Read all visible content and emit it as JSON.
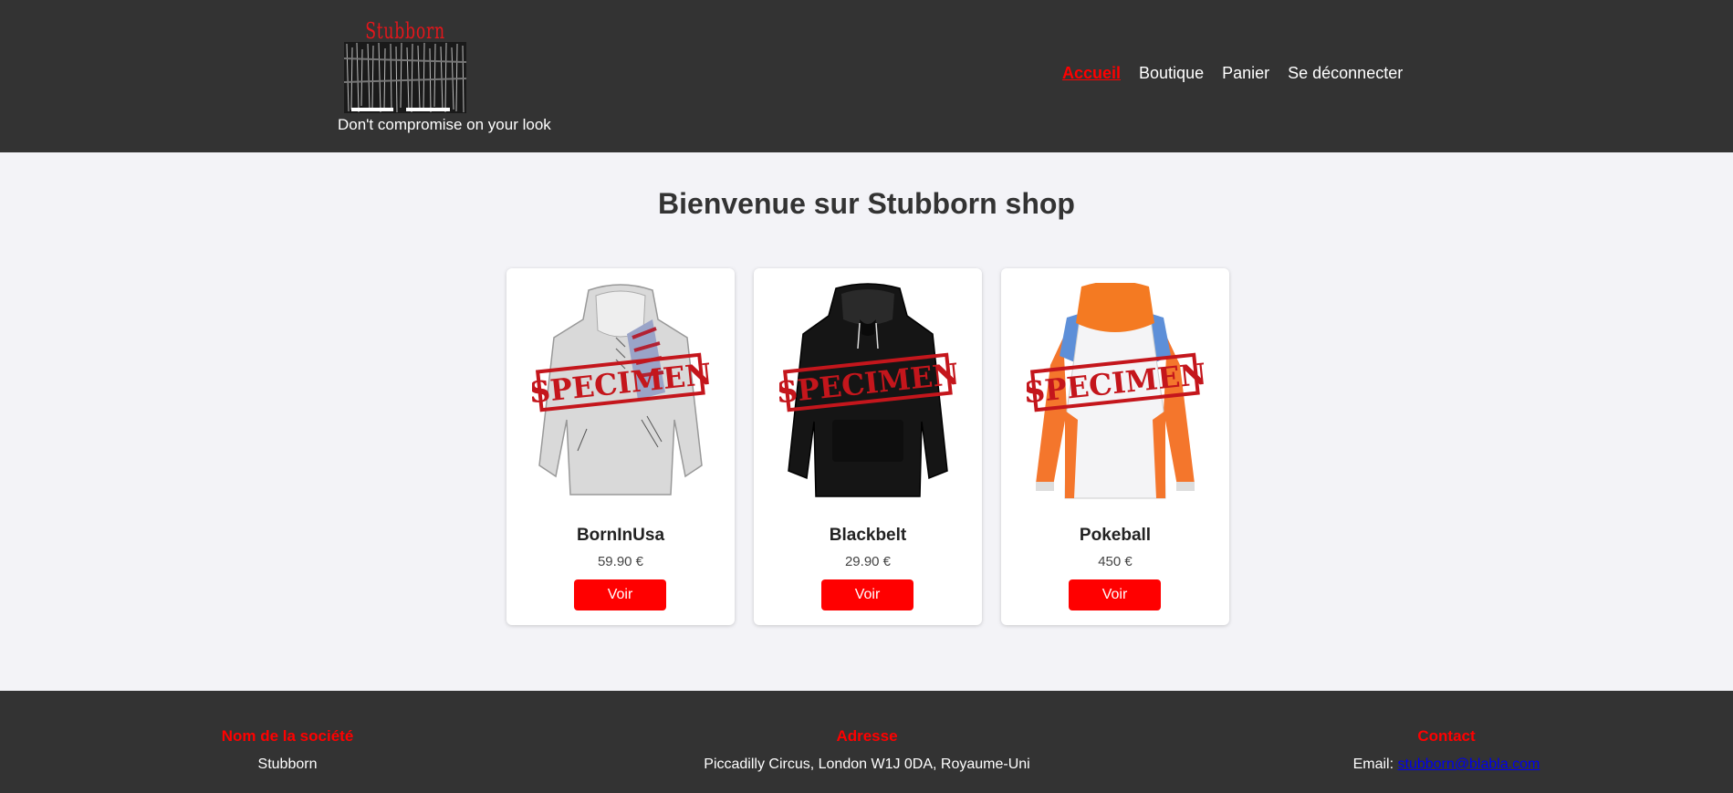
{
  "header": {
    "logo_text": "Stubborn",
    "tagline": "Don't compromise on your look",
    "nav": [
      {
        "label": "Accueil",
        "active": true
      },
      {
        "label": "Boutique",
        "active": false
      },
      {
        "label": "Panier",
        "active": false
      },
      {
        "label": "Se déconnecter",
        "active": false
      }
    ]
  },
  "main": {
    "title": "Bienvenue sur Stubborn shop",
    "watermark": "SPECIMEN",
    "products": [
      {
        "name": "BornInUsa",
        "price": "59.90 €",
        "button": "Voir",
        "image": "grey-usa-flag-hoodie"
      },
      {
        "name": "Blackbelt",
        "price": "29.90 €",
        "button": "Voir",
        "image": "black-hoodie"
      },
      {
        "name": "Pokeball",
        "price": "450 €",
        "button": "Voir",
        "image": "orange-white-blue-hoodie"
      }
    ]
  },
  "footer": {
    "company": {
      "heading": "Nom de la société",
      "value": "Stubborn"
    },
    "address": {
      "heading": "Adresse",
      "value": "Piccadilly Circus, London W1J 0DA, Royaume-Uni"
    },
    "contact": {
      "heading": "Contact",
      "email_label": "Email:",
      "email": "stubborn@blabla.com"
    }
  },
  "colors": {
    "header_bg": "#333333",
    "accent": "#ff0000",
    "page_bg": "#f3f3f7",
    "link": "#0000ee"
  }
}
